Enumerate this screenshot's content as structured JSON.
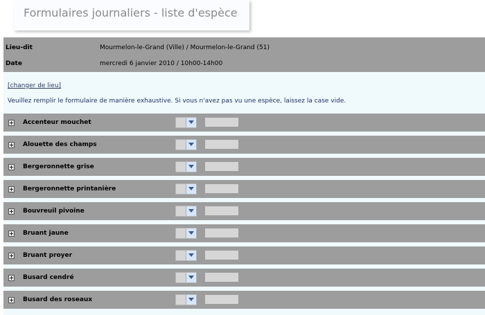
{
  "header": {
    "title": "Formulaires journaliers - liste d'espèce"
  },
  "info": {
    "rows": [
      {
        "label": "Lieu-dit",
        "value": "Mourmelon-le-Grand (Ville) / Mourmelon-le-Grand (51)"
      },
      {
        "label": "Date",
        "value": "mercredi 6 janvier 2010 / 10h00-14h00"
      }
    ]
  },
  "main": {
    "change_link": "[changer de lieu]",
    "instructions": "Veuillez remplir le formulaire de manière exhaustive. Si vous n'avez pas vu une espèce, laissez la case vide."
  },
  "species": [
    {
      "name": "Accenteur mouchet"
    },
    {
      "name": "Alouette des champs"
    },
    {
      "name": "Bergeronnette grise"
    },
    {
      "name": "Bergeronnette printanière"
    },
    {
      "name": "Bouvreuil pivoine"
    },
    {
      "name": "Bruant jaune"
    },
    {
      "name": "Bruant proyer"
    },
    {
      "name": "Busard cendré"
    },
    {
      "name": "Busard des roseaux"
    }
  ],
  "icons": {
    "expand": "plus-icon",
    "dropdown": "chevron-down-icon"
  },
  "colors": {
    "row_background": "#9d9d9d",
    "main_background": "#f0f9fc",
    "title": "#8a8a8a",
    "link": "#2b3b63"
  }
}
